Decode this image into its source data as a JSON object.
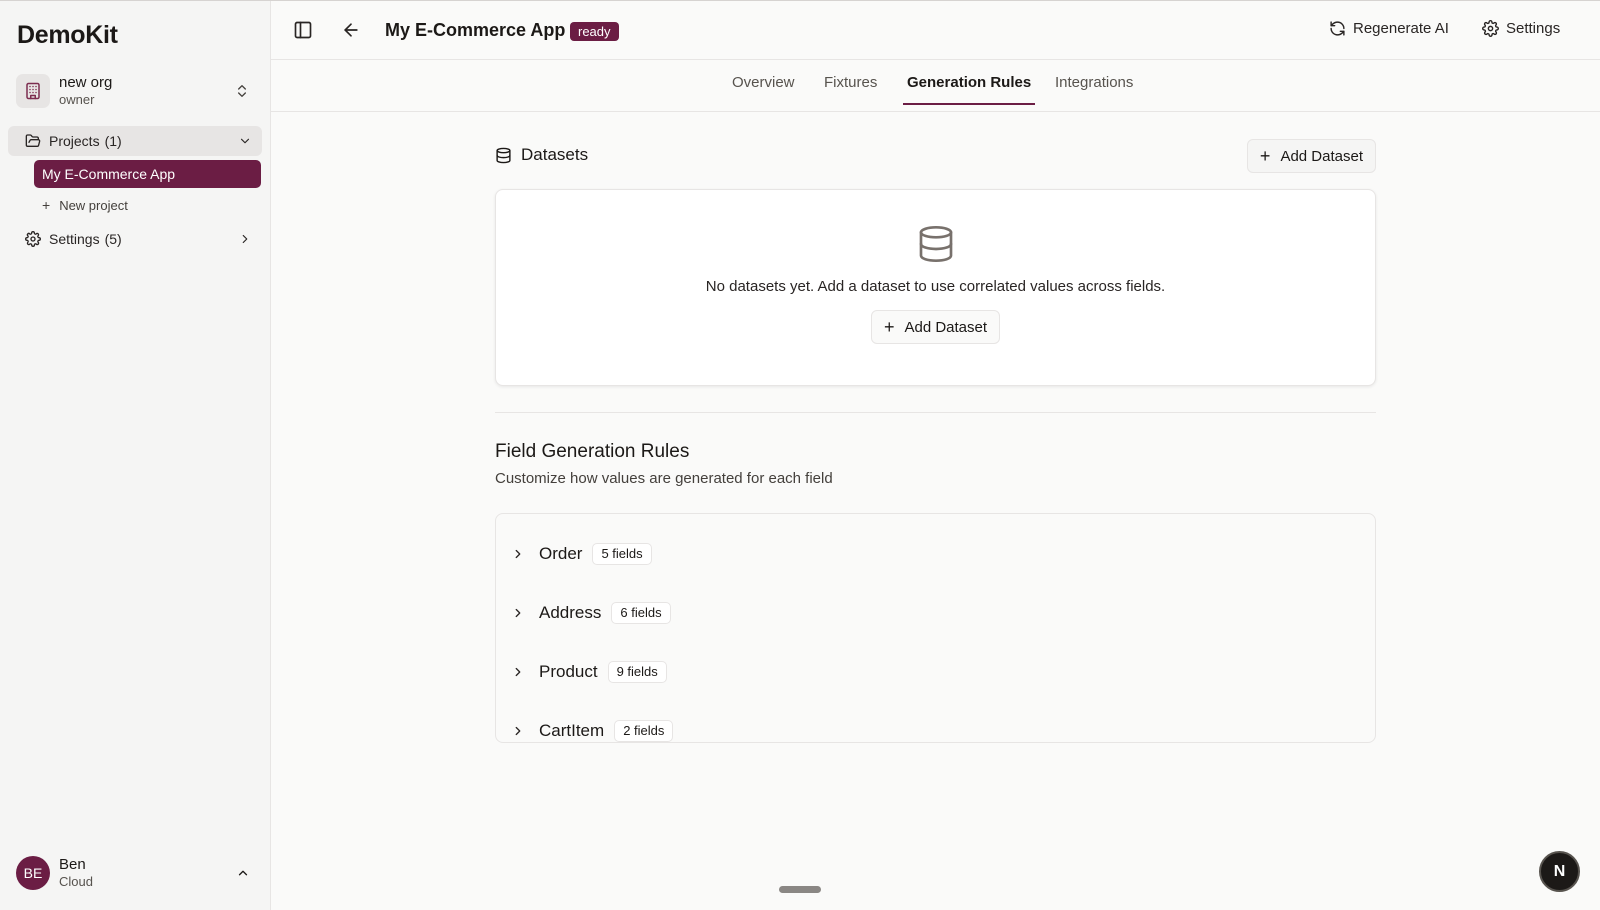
{
  "sidebar": {
    "brand": "DemoKit",
    "org": {
      "name": "new org",
      "role": "owner"
    },
    "projects": {
      "label": "Projects",
      "count": "(1)"
    },
    "active_project": "My E-Commerce App",
    "new_project": "New project",
    "settings": {
      "label": "Settings",
      "count": "(5)"
    },
    "user": {
      "initials": "BE",
      "name": "Ben",
      "plan": "Cloud"
    }
  },
  "header": {
    "title": "My E-Commerce App",
    "status": "ready",
    "regenerate": "Regenerate AI",
    "settings": "Settings"
  },
  "tabs": [
    {
      "label": "Overview",
      "active": false
    },
    {
      "label": "Fixtures",
      "active": false
    },
    {
      "label": "Generation Rules",
      "active": true
    },
    {
      "label": "Integrations",
      "active": false
    }
  ],
  "datasets": {
    "title": "Datasets",
    "add_button": "Add Dataset",
    "empty_text": "No datasets yet. Add a dataset to use correlated values across fields.",
    "empty_add_button": "Add Dataset"
  },
  "rules": {
    "title": "Field Generation Rules",
    "subtitle": "Customize how values are generated for each field",
    "models": [
      {
        "name": "Order",
        "fields": "5 fields"
      },
      {
        "name": "Address",
        "fields": "6 fields"
      },
      {
        "name": "Product",
        "fields": "9 fields"
      },
      {
        "name": "CartItem",
        "fields": "2 fields"
      }
    ]
  },
  "fab_label": "N",
  "colors": {
    "accent": "#6b1d44",
    "background": "#fafaf9",
    "sidebar": "#f5f5f4"
  }
}
